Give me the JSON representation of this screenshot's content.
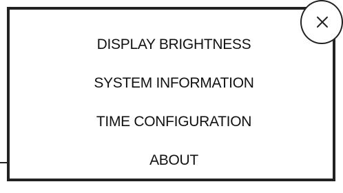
{
  "menu": {
    "items": [
      {
        "label": "DISPLAY BRIGHTNESS"
      },
      {
        "label": "SYSTEM INFORMATION"
      },
      {
        "label": "TIME CONFIGURATION"
      },
      {
        "label": "ABOUT"
      }
    ]
  },
  "close_button": {
    "icon": "close-icon"
  }
}
